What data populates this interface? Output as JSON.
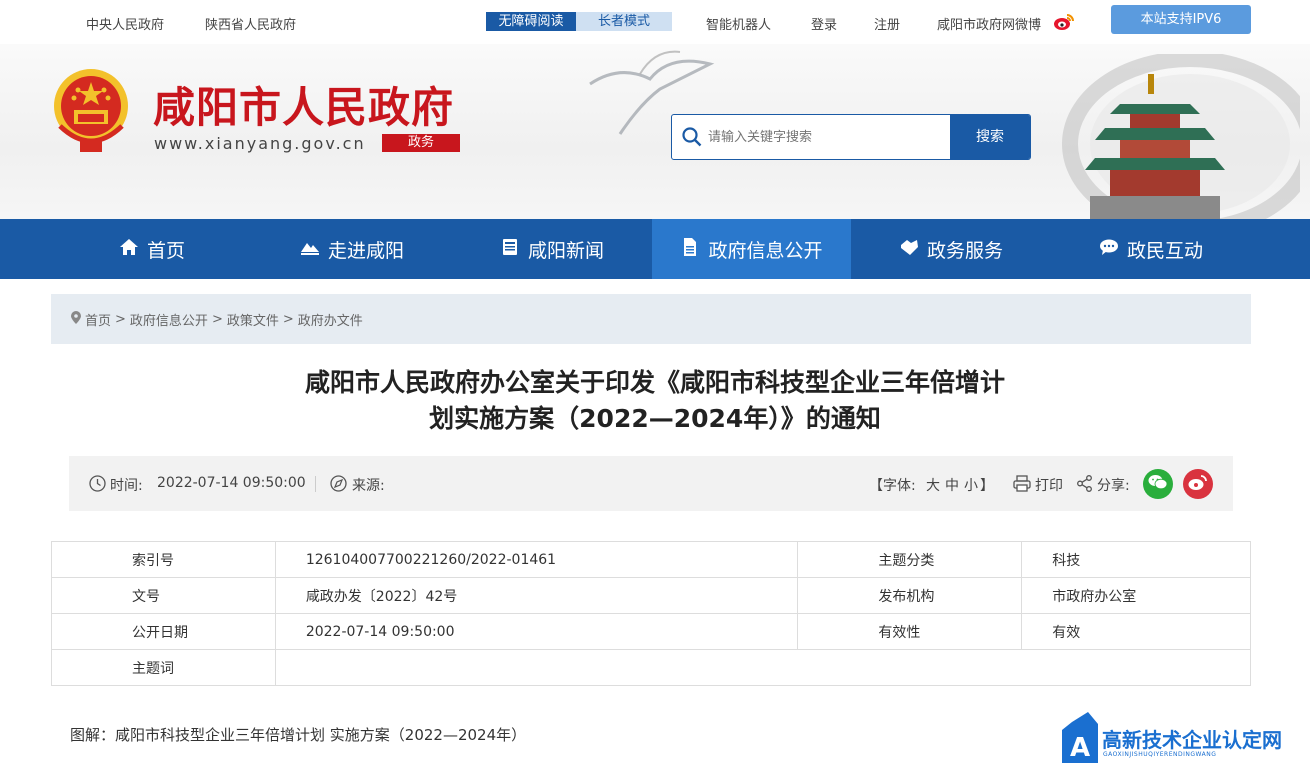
{
  "topbar": {
    "links": [
      "中央人民政府",
      "陕西省人民政府"
    ],
    "accessibility": "无障碍阅读",
    "elder_mode": "长者模式",
    "robot": "智能机器人",
    "login": "登录",
    "register": "注册",
    "weibo": "咸阳市政府网微博",
    "ipv6": "本站支持IPV6"
  },
  "header": {
    "site_title": "咸阳市人民政府",
    "site_url": "www.xianyang.gov.cn",
    "site_tag": "政务",
    "search_placeholder": "请输入关键字搜索",
    "search_button": "搜索"
  },
  "nav": [
    {
      "label": "首页",
      "icon": "home-icon"
    },
    {
      "label": "走进咸阳",
      "icon": "mountain-icon"
    },
    {
      "label": "咸阳新闻",
      "icon": "news-icon"
    },
    {
      "label": "政府信息公开",
      "icon": "document-icon",
      "active": true
    },
    {
      "label": "政务服务",
      "icon": "handshake-icon"
    },
    {
      "label": "政民互动",
      "icon": "chat-icon"
    }
  ],
  "breadcrumb": [
    "首页",
    "政府信息公开",
    "政策文件",
    "政府办文件"
  ],
  "article": {
    "title_line1": "咸阳市人民政府办公室关于印发《咸阳市科技型企业三年倍增计",
    "title_line2": "划实施方案（2022—2024年）》的通知"
  },
  "meta": {
    "time_label": "时间:",
    "time_value": "2022-07-14 09:50:00",
    "source_label": "来源:",
    "font_label": "【字体:",
    "font_large": "大",
    "font_medium": "中",
    "font_small": "小",
    "font_close": "】",
    "print": "打印",
    "share": "分享:"
  },
  "info_table": [
    [
      "索引号",
      "126104007700221260/2022-01461",
      "主题分类",
      "科技"
    ],
    [
      "文号",
      "咸政办发〔2022〕42号",
      "发布机构",
      "市政府办公室"
    ],
    [
      "公开日期",
      "2022-07-14 09:50:00",
      "有效性",
      "有效"
    ],
    [
      "主题词",
      "",
      "",
      ""
    ]
  ],
  "footer_text": "图解：咸阳市科技型企业三年倍增计划 实施方案（2022—2024年）",
  "watermark": {
    "text": "高新技术企业认定网",
    "sub": "GAOXINJISHUQIYERENDINGWANG"
  },
  "colors": {
    "primary": "#1a5aa5",
    "active_nav": "#2a78cc",
    "brand_red": "#c8161d"
  }
}
